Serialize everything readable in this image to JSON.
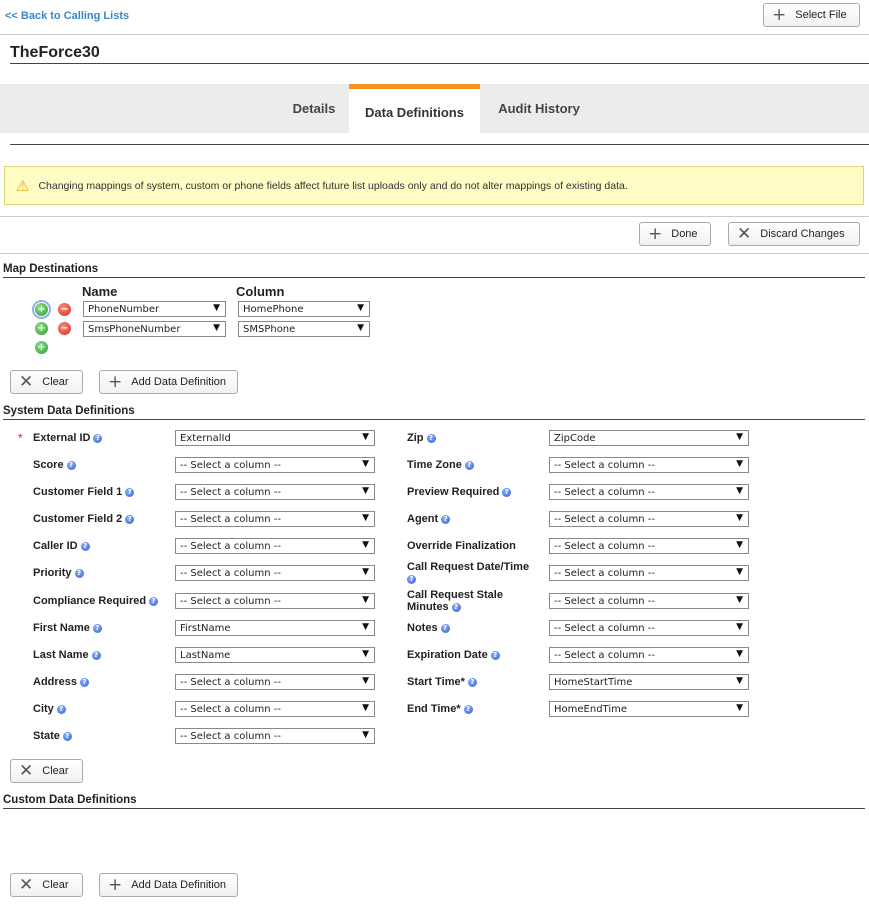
{
  "nav": {
    "back_link": "<< Back to Calling Lists",
    "select_file": "Select File"
  },
  "page": {
    "title": "TheForce30"
  },
  "tabs": [
    {
      "label": "Details",
      "active": false
    },
    {
      "label": "Data Definitions",
      "active": true
    },
    {
      "label": "Audit History",
      "active": false
    }
  ],
  "warning": {
    "text": "Changing mappings of system, custom or phone fields affect future list uploads only and do not alter mappings of existing data."
  },
  "actions": {
    "done": "Done",
    "discard": "Discard Changes"
  },
  "map_destinations": {
    "heading": "Map Destinations",
    "name_header": "Name",
    "column_header": "Column",
    "rows": [
      {
        "name": "PhoneNumber",
        "column": "HomePhone"
      },
      {
        "name": "SmsPhoneNumber",
        "column": "SMSPhone"
      }
    ],
    "clear": "Clear",
    "add": "Add Data Definition"
  },
  "system_defs": {
    "heading": "System Data Definitions",
    "left": [
      {
        "label": "External ID",
        "value": "ExternalId",
        "required": true,
        "info": true
      },
      {
        "label": "Score",
        "value": "-- Select a column --",
        "info": true
      },
      {
        "label": "Customer Field 1",
        "value": "-- Select a column --",
        "info": true
      },
      {
        "label": "Customer Field 2",
        "value": "-- Select a column --",
        "info": true
      },
      {
        "label": "Caller ID",
        "value": "-- Select a column --",
        "info": true
      },
      {
        "label": "Priority",
        "value": "-- Select a column --",
        "info": true
      },
      {
        "label": "Compliance Required",
        "value": "-- Select a column --",
        "info": true
      },
      {
        "label": "First Name",
        "value": "FirstName",
        "info": true
      },
      {
        "label": "Last Name",
        "value": "LastName",
        "info": true
      },
      {
        "label": "Address",
        "value": "-- Select a column --",
        "info": true
      },
      {
        "label": "City",
        "value": "-- Select a column --",
        "info": true
      },
      {
        "label": "State",
        "value": "-- Select a column --",
        "info": true
      }
    ],
    "right": [
      {
        "label": "Zip",
        "value": "ZipCode",
        "info": true
      },
      {
        "label": "Time Zone",
        "value": "-- Select a column --",
        "info": true
      },
      {
        "label": "Preview Required",
        "value": "-- Select a column --",
        "info": true
      },
      {
        "label": "Agent",
        "value": "-- Select a column --",
        "info": true
      },
      {
        "label": "Override Finalization",
        "value": "-- Select a column --",
        "info": false
      },
      {
        "label": "Call Request Date/Time",
        "value": "-- Select a column --",
        "info": true,
        "info_below": true
      },
      {
        "label": "Call Request Stale Minutes",
        "value": "-- Select a column --",
        "info": true,
        "wrap": true
      },
      {
        "label": "Notes",
        "value": "-- Select a column --",
        "info": true
      },
      {
        "label": "Expiration Date",
        "value": "-- Select a column --",
        "info": true
      },
      {
        "label": "Start Time*",
        "value": "HomeStartTime",
        "info": true
      },
      {
        "label": "End Time*",
        "value": "HomeEndTime",
        "info": true
      }
    ],
    "clear": "Clear"
  },
  "custom_defs": {
    "heading": "Custom Data Definitions",
    "clear": "Clear",
    "add": "Add Data Definition"
  },
  "icons": {
    "plus": "plus-icon",
    "close": "close-icon",
    "warning": "warning-icon",
    "info": "info-icon",
    "dropdown": "chevron-down-icon"
  },
  "colors": {
    "accent_tab": "#f7941e",
    "link": "#3a87c8",
    "warning_bg": "#fefbc4"
  }
}
